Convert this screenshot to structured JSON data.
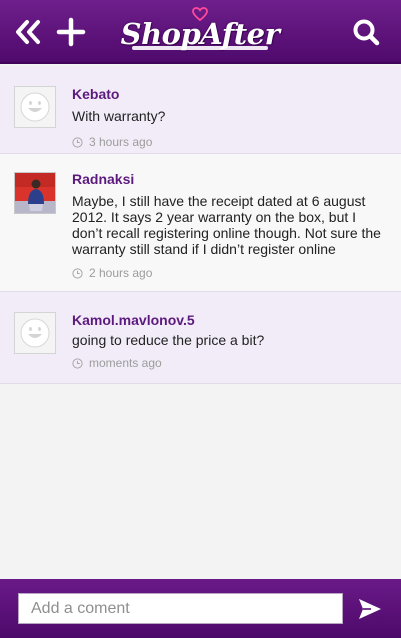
{
  "header": {
    "logo_text": "ShopAfter",
    "back_icon": "double-chevron-left-icon",
    "add_icon": "plus-icon",
    "search_icon": "search-icon"
  },
  "comments": [
    {
      "author": "Kebato",
      "text": "With warranty?",
      "time": "3 hours ago",
      "avatar": "placeholder-face"
    },
    {
      "author": "Radnaksi",
      "text": "Maybe, I still have the receipt dated at 6 august 2012. It says 2 year warranty on the box, but I don’t recall  registering online though. Not sure the warranty still stand if I didn’t register online",
      "time": "2 hours ago",
      "avatar": "photo"
    },
    {
      "author": "Kamol.mavlonov.5",
      "text": "going to reduce the price a bit?",
      "time": "moments ago",
      "avatar": "placeholder-face"
    }
  ],
  "footer": {
    "input_placeholder": "Add a coment",
    "input_value": "",
    "send_icon": "send-icon"
  },
  "colors": {
    "brand_purple": "#5b1279",
    "author_purple": "#5d1a7e",
    "row_highlight": "#f2ecf8",
    "background": "#f3f3f3"
  }
}
